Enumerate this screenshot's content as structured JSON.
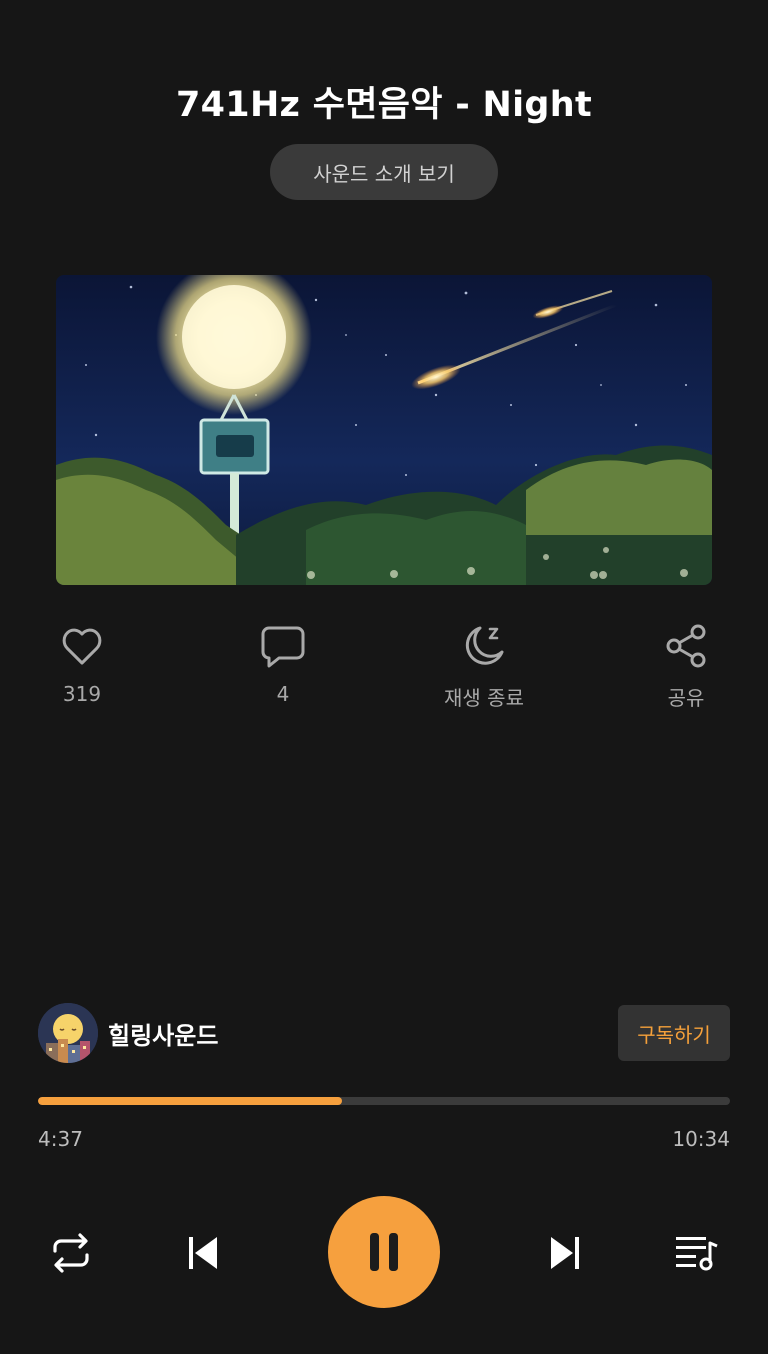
{
  "player": {
    "title": "741Hz 수면음악 - Night",
    "intro_button": "사운드 소개 보기",
    "artwork_icon": "night-scene-lamp-meteor-artwork"
  },
  "actions": {
    "like_count": "319",
    "comment_count": "4",
    "sleep_timer_label": "재생 종료",
    "share_label": "공유"
  },
  "channel": {
    "name": "힐링사운드",
    "subscribe_label": "구독하기"
  },
  "playback": {
    "current_time": "4:37",
    "total_time": "10:34",
    "progress_fraction": 0.44
  },
  "controls": {
    "repeat_icon": "repeat-icon",
    "previous_icon": "skip-previous-icon",
    "pause_icon": "pause-icon",
    "next_icon": "skip-next-icon",
    "playlist_icon": "playlist-icon"
  },
  "colors": {
    "accent": "#f6a03e",
    "background": "#161616"
  }
}
